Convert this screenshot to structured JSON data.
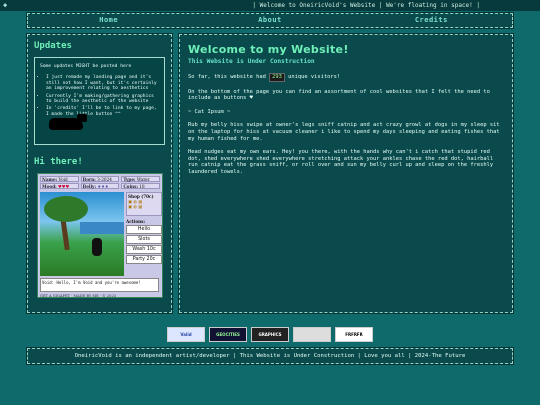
{
  "topbar": {
    "ticker": "| Welcome to OneiricVoid's Website | We're floating in space! |"
  },
  "nav": {
    "items": [
      "Home",
      "About",
      "Credits"
    ]
  },
  "sidebar": {
    "updates_title": "Updates",
    "updates_intro": "Some updates MIGHT be posted here",
    "updates_items": [
      "I just remade my landing page and it's still not how I want, but it's certainly an improvement relating to aesthetics",
      "Currently I'm making/gathering graphics to build the aesthetic of the website",
      "In 'credits' I'll be to link to my page, I made the little button ^^"
    ],
    "hithere_title": "Hi there!"
  },
  "pet": {
    "name_label": "Name:",
    "name": "Void",
    "born_label": "Born:",
    "born": "3-2024",
    "type_label": "Type:",
    "type": "Water",
    "mood_label": "Mood:",
    "mood": "♥♥♥",
    "belly_label": "Belly:",
    "belly": "♦♦♦",
    "coins_label": "Coins:",
    "coins": "18",
    "shop_label": "Shop (70c)",
    "actions_label": "Actions:",
    "actions": [
      "Hello",
      "Slots",
      "Wash 10c",
      "Party 20c"
    ],
    "speech": "Void: Hello, I'm Void and you're awesome!",
    "footer": "GET A GIGAPET · MADE BY ME · © 2023"
  },
  "main": {
    "title": "Welcome to my Website!",
    "subtitle": "This Website is Under Construction",
    "visitors_pre": "So far, this website had",
    "visitors_count": "293",
    "visitors_post": "unique visitors!",
    "p2": "On the bottom of the page you can find an assortment of cool websites that I felt the need to include as buttons ♥",
    "p3": "~ Cat Ipsum ~",
    "p4": "Rub my belly hiss swipe at owner's legs sniff catnip and act crazy growl at dogs in my sleep sit on the laptop for hiss at vacuum cleaner i like to spend my days sleeping and eating fishes that my human fished for me.",
    "p5": "Head nudges eat my own ears. Hey! you there, with the hands why can't i catch that stupid red dot, shed everywhere shed everywhere stretching attack your ankles chase the red dot, hairball run catnip eat the grass sniff, or roll over and sun my belly curl up and sleep on the freshly laundered towels."
  },
  "badges": [
    "Valid",
    "GEOCITIES",
    "GRAPHICS",
    "",
    "FRFRFR"
  ],
  "footer": {
    "text": "OneiricVoid is an independent artist/developer | This Website is Under Construction | Love you all | 2024-The Future"
  }
}
